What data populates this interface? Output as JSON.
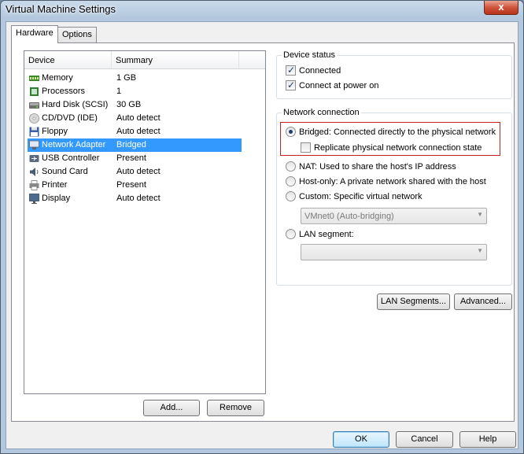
{
  "window": {
    "title": "Virtual Machine Settings",
    "close_glyph": "x"
  },
  "tabs": [
    {
      "label": "Hardware"
    },
    {
      "label": "Options"
    }
  ],
  "device_table": {
    "columns": [
      "Device",
      "Summary"
    ],
    "rows": [
      {
        "icon": "memory-icon",
        "device": "Memory",
        "summary": "1 GB"
      },
      {
        "icon": "processor-icon",
        "device": "Processors",
        "summary": "1"
      },
      {
        "icon": "hard-disk-icon",
        "device": "Hard Disk (SCSI)",
        "summary": "30 GB"
      },
      {
        "icon": "cd-dvd-icon",
        "device": "CD/DVD (IDE)",
        "summary": "Auto detect"
      },
      {
        "icon": "floppy-icon",
        "device": "Floppy",
        "summary": "Auto detect"
      },
      {
        "icon": "network-adapter-icon",
        "device": "Network Adapter",
        "summary": "Bridged"
      },
      {
        "icon": "usb-icon",
        "device": "USB Controller",
        "summary": "Present"
      },
      {
        "icon": "sound-card-icon",
        "device": "Sound Card",
        "summary": "Auto detect"
      },
      {
        "icon": "printer-icon",
        "device": "Printer",
        "summary": "Present"
      },
      {
        "icon": "display-icon",
        "device": "Display",
        "summary": "Auto detect"
      }
    ],
    "selected_device": "Network Adapter"
  },
  "list_buttons": {
    "add": "Add...",
    "remove": "Remove"
  },
  "device_status": {
    "title": "Device status",
    "connected": {
      "label": "Connected",
      "checked": true
    },
    "connect_at_power_on": {
      "label": "Connect at power on",
      "checked": true
    }
  },
  "network_connection": {
    "title": "Network connection",
    "bridged": {
      "label": "Bridged: Connected directly to the physical network",
      "selected": true
    },
    "replicate": {
      "label": "Replicate physical network connection state",
      "checked": false
    },
    "nat": {
      "label": "NAT: Used to share the host's IP address",
      "selected": false
    },
    "host_only": {
      "label": "Host-only: A private network shared with the host",
      "selected": false
    },
    "custom": {
      "label": "Custom: Specific virtual network",
      "selected": false
    },
    "custom_network_value": "VMnet0 (Auto-bridging)",
    "lan_segment": {
      "label": "LAN segment:",
      "selected": false
    },
    "lan_segment_value": ""
  },
  "network_buttons": {
    "lan_segments": "LAN Segments...",
    "advanced": "Advanced..."
  },
  "dialog_buttons": {
    "ok": "OK",
    "cancel": "Cancel",
    "help": "Help"
  },
  "colors": {
    "selection": "#3399ff",
    "highlight_border": "#c81e1e",
    "title_bar": "#b3c8de"
  }
}
